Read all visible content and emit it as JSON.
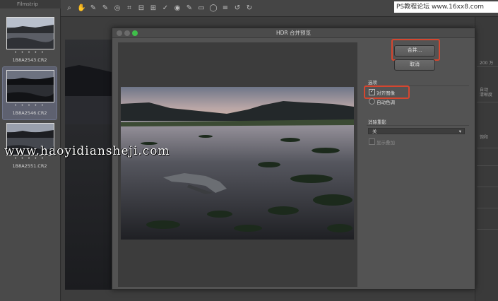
{
  "filmstrip": {
    "header": "Filmstrip",
    "items": [
      {
        "stars": "• • • • •",
        "name": "1B8A2543.CR2",
        "selected": false
      },
      {
        "stars": "• • • • •",
        "name": "1B8A2546.CR2",
        "selected": true
      },
      {
        "stars": "• • • • •",
        "name": "1B8A2551.CR2",
        "selected": false
      }
    ]
  },
  "toolbar": {
    "icons": [
      "zoom-icon",
      "hand-icon",
      "white-balance-icon",
      "color-sampler-icon",
      "target-adjust-icon",
      "crop-icon",
      "straighten-icon",
      "transform-icon",
      "spot-removal-icon",
      "red-eye-icon",
      "adjustment-brush-icon",
      "graduated-filter-icon",
      "radial-filter-icon",
      "preferences-icon",
      "rotate-left-icon",
      "rotate-right-icon"
    ]
  },
  "dialog": {
    "title": "HDR 合并预览",
    "merge_button": "合并...",
    "cancel_button": "取消",
    "options_heading": "选项",
    "align_images_label": "对齐图像",
    "align_images_checked": true,
    "auto_tone_label": "自动色调",
    "deghost_heading": "消除重影",
    "deghost_value": "关",
    "show_overlay_label": "显示叠加"
  },
  "right_panel": {
    "labels": [
      "200 万",
      "自动",
      "清晰度",
      "饱和"
    ]
  },
  "watermarks": {
    "site": "www.haoyidiansheji.com",
    "forum": "PS教程论坛 www.16xx8.com"
  },
  "colors": {
    "callout": "#d5462f",
    "traffic_close": "#6b6b6b",
    "traffic_min": "#6b6b6b",
    "traffic_max": "#3fbe4a",
    "selected_thumb": "#5e6170"
  }
}
